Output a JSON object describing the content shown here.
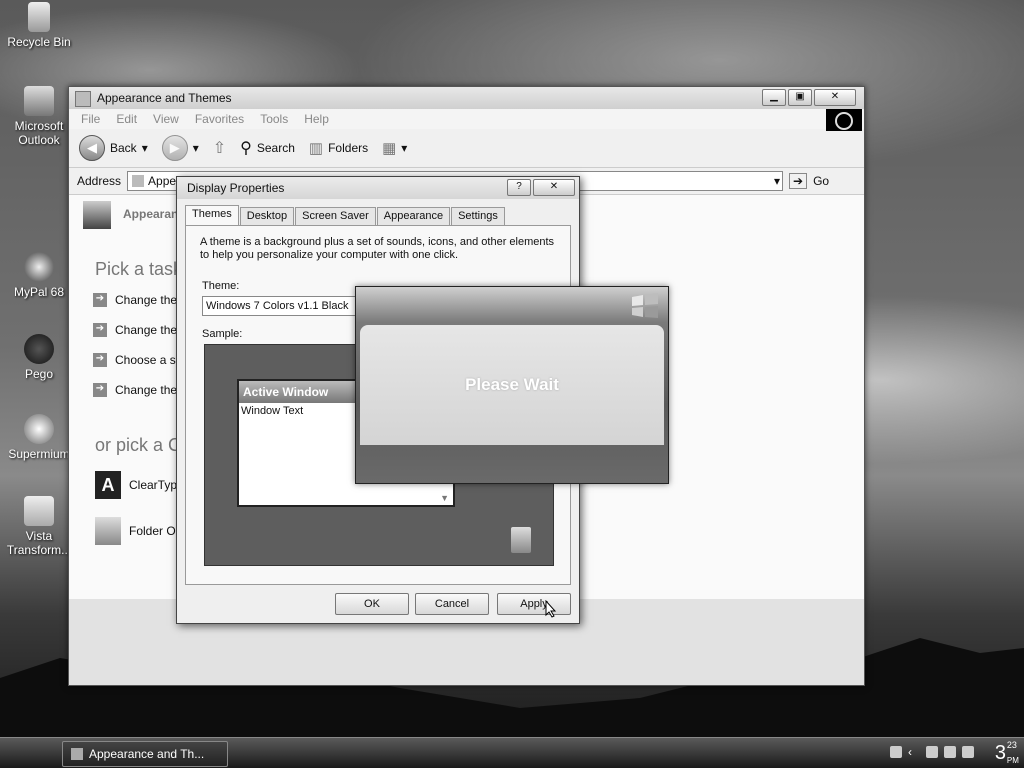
{
  "desktop": {
    "icons": [
      {
        "label": "Recycle Bin",
        "icon": "recycle-bin-icon"
      },
      {
        "label": "Microsoft Outlook",
        "icon": "outlook-icon"
      },
      {
        "label": "MyPal 68",
        "icon": "mypal-icon"
      },
      {
        "label": "Pego",
        "icon": "pego-icon"
      },
      {
        "label": "Supermium",
        "icon": "supermium-icon"
      },
      {
        "label": "Vista Transform...",
        "icon": "vista-transform-icon"
      }
    ]
  },
  "explorer": {
    "title": "Appearance and Themes",
    "menu": [
      "File",
      "Edit",
      "View",
      "Favorites",
      "Tools",
      "Help"
    ],
    "toolbar": {
      "back": "Back",
      "search": "Search",
      "folders": "Folders"
    },
    "address": {
      "label": "Address",
      "value": "Appea",
      "go": "Go"
    },
    "side_heading": "Appearance",
    "pick_task": "Pick a task...",
    "tasks": [
      "Change the",
      "Change the",
      "Choose a sc",
      "Change the"
    ],
    "pick_icon": "or pick a C",
    "icons": [
      {
        "label": "ClearType",
        "icon": "cleartype-icon"
      },
      {
        "label": "Folder O",
        "icon": "folder-options-icon"
      }
    ]
  },
  "dialog": {
    "title": "Display Properties",
    "tabs": [
      "Themes",
      "Desktop",
      "Screen Saver",
      "Appearance",
      "Settings"
    ],
    "active_tab": "Themes",
    "description": "A theme is a background plus a set of sounds, icons, and other elements to help you personalize your computer with one click.",
    "theme_label": "Theme:",
    "theme_value": "Windows 7 Colors v1.1 Black",
    "sample_label": "Sample:",
    "sample_window_title": "Active Window",
    "sample_window_text": "Window Text",
    "buttons": {
      "ok": "OK",
      "cancel": "Cancel",
      "apply": "Apply"
    }
  },
  "please_wait": {
    "text": "Please Wait"
  },
  "taskbar": {
    "task_label": "Appearance and Th...",
    "clock": {
      "hour": "3",
      "minute": "23",
      "ampm": "PM"
    }
  }
}
